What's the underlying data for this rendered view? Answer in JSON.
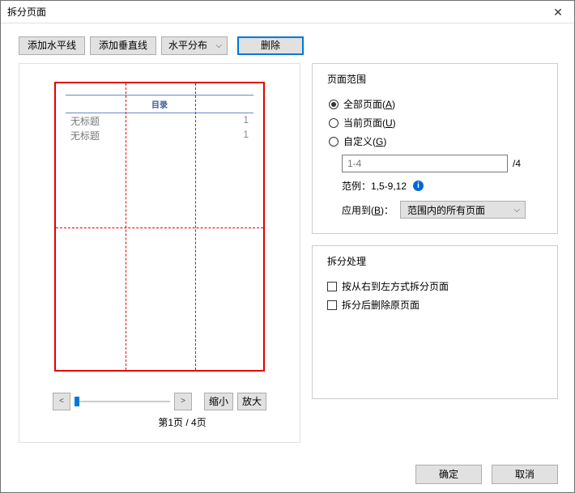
{
  "title": "拆分页面",
  "toolbar": {
    "add_h": "添加水平线",
    "add_v": "添加垂直线",
    "dist": "水平分布",
    "delete": "删除"
  },
  "doc": {
    "mulu": "目录",
    "row1_l": "无标题",
    "row1_r": "1",
    "row2_l": "无标题",
    "row2_r": "1"
  },
  "nav": {
    "prev": "<",
    "next": ">",
    "zout": "缩小",
    "zin": "放大",
    "page_label": "第1页 / 4页"
  },
  "range": {
    "legend": "页面范围",
    "all": "全部页面(",
    "all_u": "A",
    "close": ")",
    "cur": "当前页面(",
    "cur_u": "U",
    "cust": "自定义(",
    "cust_u": "G",
    "input_ph": "1-4",
    "slash": "/4",
    "example": "范例：1,5-9,12",
    "applyto": "应用到(",
    "applyto_u": "B",
    "applyto_colon": ")：",
    "applyto_val": "范围内的所有页面"
  },
  "process": {
    "legend": "拆分处理",
    "rtl": "按从右到左方式拆分页面",
    "del": "拆分后删除原页面"
  },
  "footer": {
    "ok": "确定",
    "cancel": "取消"
  }
}
